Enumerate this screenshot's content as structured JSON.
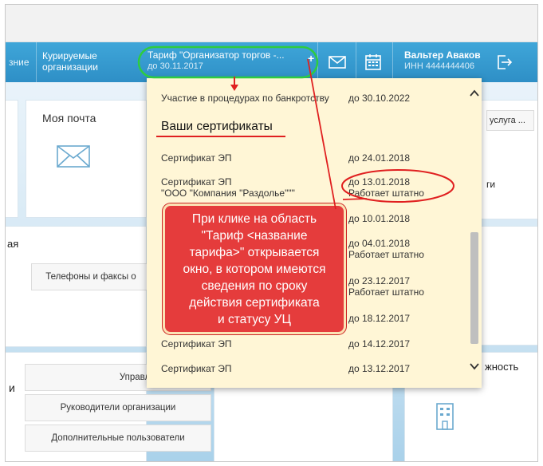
{
  "navbar": {
    "left_edge": "зние",
    "supervised": [
      "Курируемые",
      "организации"
    ],
    "tariff_title": "Тариф \"Организатор торгов -...",
    "tariff_until": "до 30.11.2017",
    "tariff_plus": "+",
    "user_name": "Вальтер Аваков",
    "user_inn": "ИНН 4444444406"
  },
  "tiles": {
    "mail_title": "Моя почта",
    "left_edge_word": "ая",
    "phones_button": "Телефоны и факсы о",
    "service_field": "услуга ...",
    "right_edge_word": "ги",
    "right_lower_word": "жность",
    "lower_left_edge": "и",
    "roles_button": "Управление рол",
    "managers_button": "Руководители организации",
    "extra_users_button": "Дополнительные пользователи"
  },
  "dropdown": {
    "top_row_label": "Участие в процедурах по банкротству",
    "top_row_date": "до 30.10.2022",
    "heading": "Ваши сертификаты",
    "certs": [
      {
        "label": "Сертификат ЭП",
        "org": "",
        "date": "до 24.01.2018",
        "status": ""
      },
      {
        "label": "Сертификат ЭП",
        "org": "\"ООО \"Компания \"Раздолье\"\"\"",
        "date": "до 13.01.2018",
        "status": "Работает штатно"
      },
      {
        "label": "",
        "org": "",
        "date": "до 10.01.2018",
        "status": ""
      },
      {
        "label": "",
        "org": "",
        "date": "до 04.01.2018",
        "status": "Работает штатно"
      },
      {
        "label": "",
        "org": "",
        "date": "до 23.12.2017",
        "status": "Работает штатно"
      },
      {
        "label": "",
        "org": "",
        "date": "до 18.12.2017",
        "status": ""
      },
      {
        "label": "Сертификат ЭП",
        "org": "",
        "date": "до 14.12.2017",
        "status": ""
      },
      {
        "label": "Сертификат ЭП",
        "org": "",
        "date": "до 13.12.2017",
        "status": ""
      }
    ]
  },
  "callout": {
    "lines": [
      "При клике на область",
      "\"Тариф <название",
      "тарифа>\" открывается",
      "окно, в котором имеются",
      "сведения по сроку",
      "действия сертификата",
      "и статусу УЦ"
    ]
  },
  "colors": {
    "navbar": "#3fa6d9",
    "dropdown_bg": "#fff6d6",
    "callout_bg": "#e53c3c",
    "highlight_green": "#2ecc40",
    "annotation_red": "#e02020"
  }
}
